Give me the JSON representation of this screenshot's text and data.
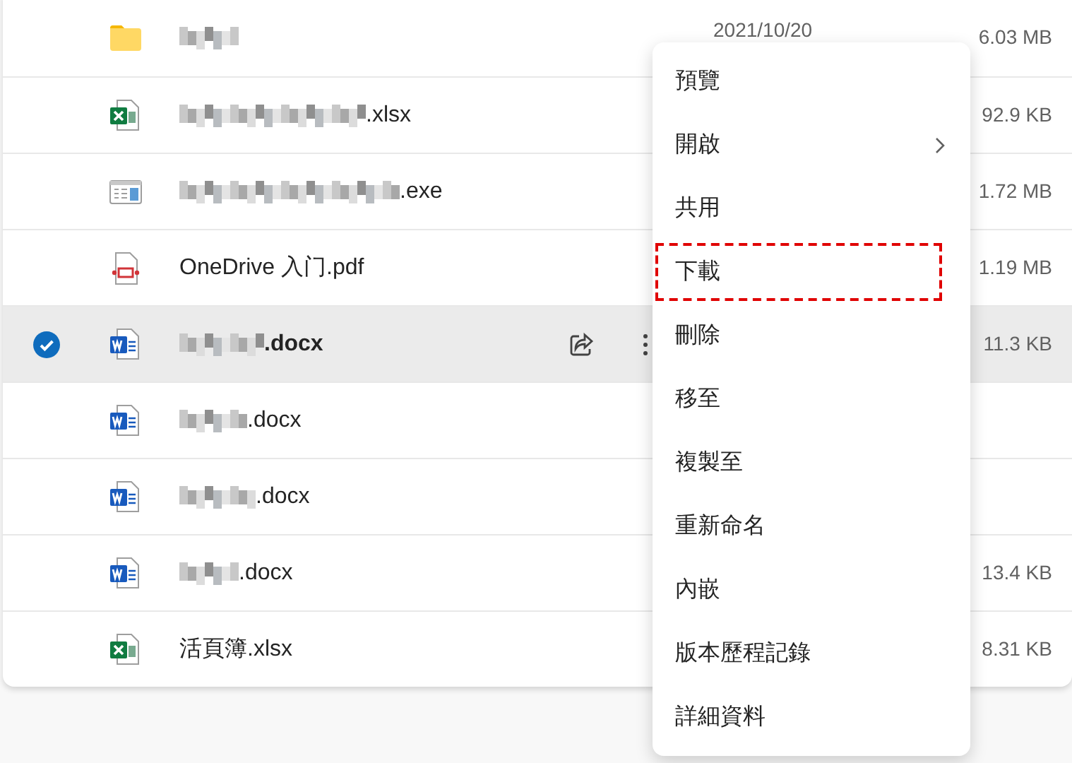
{
  "files": [
    {
      "kind": "folder",
      "redacted": true,
      "selected": false,
      "date": "2021/10/20",
      "size": "6.03 MB"
    },
    {
      "kind": "excel",
      "name": ".xlsx",
      "redacted": true,
      "selected": false,
      "size": "92.9 KB"
    },
    {
      "kind": "exe",
      "name": ".exe",
      "redacted": true,
      "selected": false,
      "size": "1.72 MB"
    },
    {
      "kind": "pdf",
      "name": "OneDrive 入门.pdf",
      "redacted": false,
      "selected": false,
      "size": "1.19 MB"
    },
    {
      "kind": "word",
      "name": ".docx",
      "redacted": true,
      "selected": true,
      "size": "11.3 KB"
    },
    {
      "kind": "word",
      "name": ".docx",
      "redacted": true,
      "selected": false
    },
    {
      "kind": "word",
      "name": ".docx",
      "redacted": true,
      "selected": false
    },
    {
      "kind": "word",
      "name": ".docx",
      "redacted": true,
      "selected": false,
      "size": "13.4 KB"
    },
    {
      "kind": "excel",
      "name": "活頁簿.xlsx",
      "redacted": false,
      "selected": false,
      "size": "8.31 KB"
    }
  ],
  "context_menu": [
    {
      "label": "預覽",
      "submenu": false,
      "highlighted": false
    },
    {
      "label": "開啟",
      "submenu": true,
      "highlighted": false
    },
    {
      "label": "共用",
      "submenu": false,
      "highlighted": false
    },
    {
      "label": "下載",
      "submenu": false,
      "highlighted": true
    },
    {
      "label": "刪除",
      "submenu": false,
      "highlighted": false
    },
    {
      "label": "移至",
      "submenu": false,
      "highlighted": false
    },
    {
      "label": "複製至",
      "submenu": false,
      "highlighted": false
    },
    {
      "label": "重新命名",
      "submenu": false,
      "highlighted": false
    },
    {
      "label": "內嵌",
      "submenu": false,
      "highlighted": false
    },
    {
      "label": "版本歷程記錄",
      "submenu": false,
      "highlighted": false
    },
    {
      "label": "詳細資料",
      "submenu": false,
      "highlighted": false
    }
  ]
}
